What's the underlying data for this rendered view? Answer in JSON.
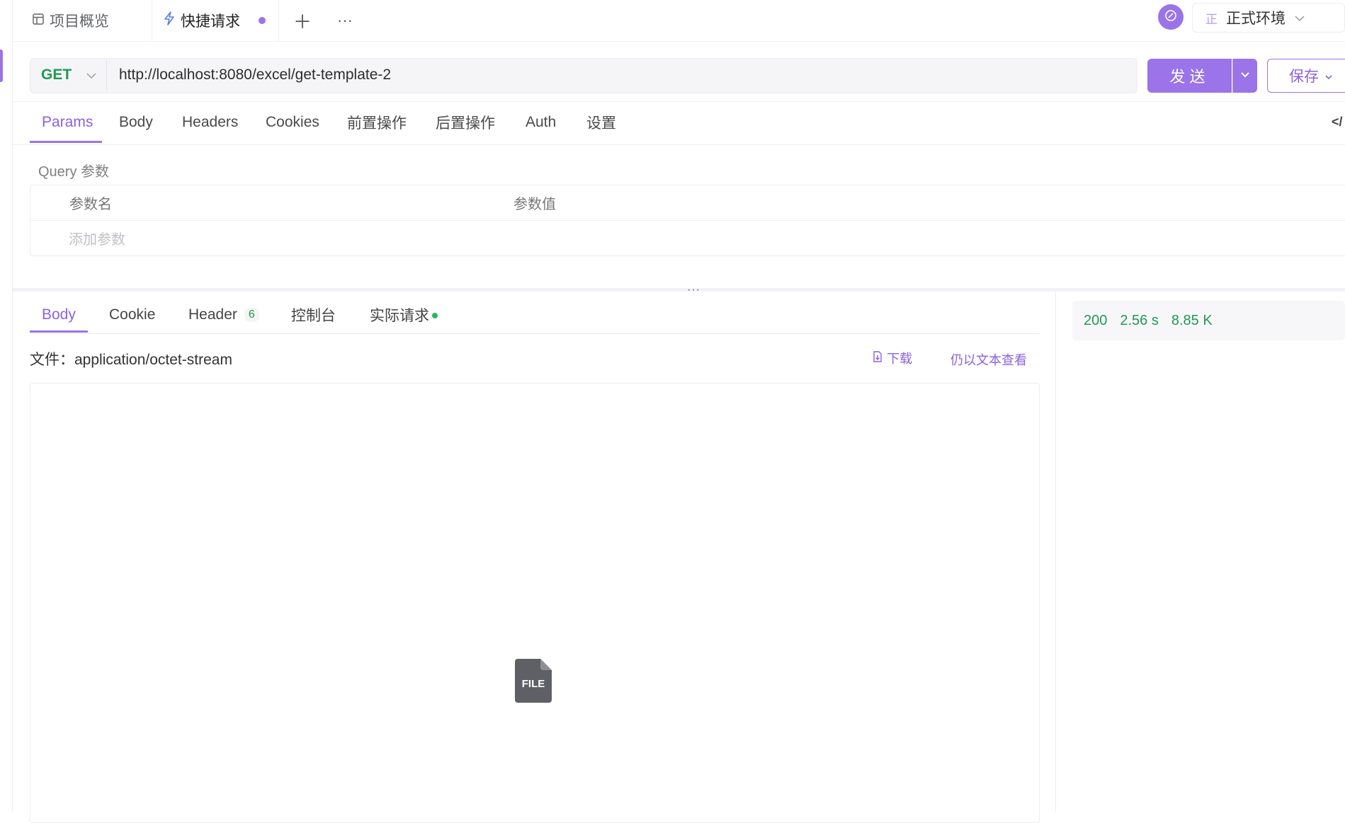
{
  "tabs": {
    "overview": "项目概览",
    "quick": "快捷请求"
  },
  "env": {
    "badge": "正",
    "name": "正式环境"
  },
  "request": {
    "method": "GET",
    "url": "http://localhost:8080/excel/get-template-2",
    "send": "发送",
    "save": "保存"
  },
  "req_tabs": [
    "Params",
    "Body",
    "Headers",
    "Cookies",
    "前置操作",
    "后置操作",
    "Auth",
    "设置"
  ],
  "params": {
    "section": "Query 参数",
    "col_name": "参数名",
    "col_value": "参数值",
    "add": "添加参数"
  },
  "response": {
    "tabs": {
      "body": "Body",
      "cookie": "Cookie",
      "header": "Header",
      "header_count": "6",
      "console": "控制台",
      "actual": "实际请求"
    },
    "file_type": "文件：application/octet-stream",
    "download": "下载",
    "view_text": "仍以文本查看",
    "file_icon_label": "FILE"
  },
  "status": {
    "code": "200",
    "time": "2.56 s",
    "size": "8.85 K"
  },
  "colors": {
    "accent": "#9a74e8",
    "method": "#1f9a54",
    "status": "#1f9a54"
  }
}
